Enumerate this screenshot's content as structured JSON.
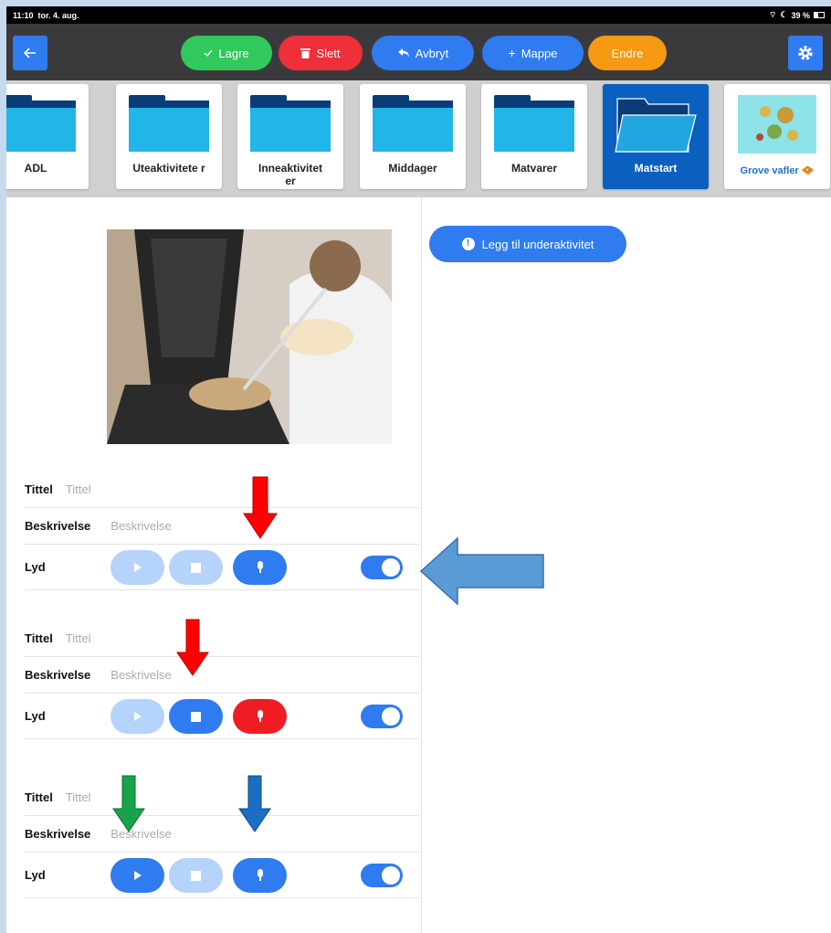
{
  "status": {
    "time": "11:10",
    "date": "tor. 4. aug.",
    "battery": "39 %"
  },
  "toolbar": {
    "back_icon": "arrow-left-icon",
    "buttons": [
      {
        "label": "Lagre",
        "icon": "checkmark-icon",
        "color": "#2fc95c"
      },
      {
        "label": "Slett",
        "icon": "trash-icon",
        "color": "#ef2f3a"
      },
      {
        "label": "Avbryt",
        "icon": "undo-icon",
        "color": "#2f7bf0"
      },
      {
        "label": "Mappe",
        "icon": "plus-icon",
        "color": "#2f7bf0"
      },
      {
        "label": "Endre",
        "icon": "",
        "color": "#f79a13"
      }
    ],
    "settings_icon": "gear-icon"
  },
  "folders": [
    {
      "label": "ADL"
    },
    {
      "label": "Uteaktivitete r"
    },
    {
      "label": "Inneaktivitet er"
    },
    {
      "label": "Middager"
    },
    {
      "label": "Matvarer"
    },
    {
      "label": "Matstart",
      "selected": true
    },
    {
      "label": "Grove vafler",
      "kind": "image"
    }
  ],
  "add_subactivity": {
    "label": "Legg til underaktivitet",
    "icon": "info-icon"
  },
  "entries": [
    {
      "title_label": "Tittel",
      "title_placeholder": "Tittel",
      "desc_label": "Beskrivelse",
      "desc_placeholder": "Beskrivelse",
      "sound_label": "Lyd",
      "play": "inactive",
      "stop": "inactive",
      "record": "active",
      "toggle": "on"
    },
    {
      "title_label": "Tittel",
      "title_placeholder": "Tittel",
      "desc_label": "Beskrivelse",
      "desc_placeholder": "Beskrivelse",
      "sound_label": "Lyd",
      "play": "inactive",
      "stop": "active",
      "record": "recording",
      "toggle": "on"
    },
    {
      "title_label": "Tittel",
      "title_placeholder": "Tittel",
      "desc_label": "Beskrivelse",
      "desc_placeholder": "Beskrivelse",
      "sound_label": "Lyd",
      "play": "active",
      "stop": "inactive",
      "record": "active",
      "toggle": "on"
    }
  ],
  "colors": {
    "accent": "#2f7bf0",
    "accent_light": "#b6d3fb",
    "record_red": "#ef1c24",
    "save_green": "#2fc95c",
    "edit_orange": "#f79a13",
    "selected_folder": "#0a5fbf"
  }
}
